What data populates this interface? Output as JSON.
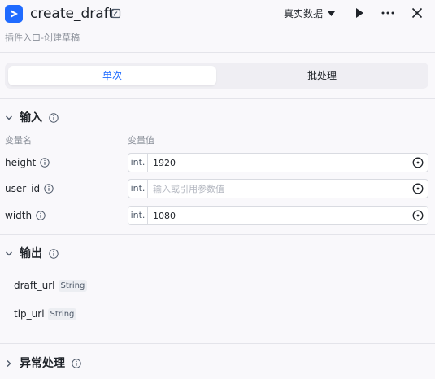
{
  "header": {
    "title": "create_draft",
    "subtitle": "插件入口-创建草稿",
    "mode_label": "真实数据"
  },
  "tabs": [
    {
      "label": "单次",
      "active": true
    },
    {
      "label": "批处理",
      "active": false
    }
  ],
  "input_section": {
    "title": "输入",
    "col_name": "变量名",
    "col_value": "变量值",
    "params": [
      {
        "name": "height",
        "type": "int.",
        "value": "1920",
        "placeholder": ""
      },
      {
        "name": "user_id",
        "type": "int.",
        "value": "",
        "placeholder": "输入或引用参数值"
      },
      {
        "name": "width",
        "type": "int.",
        "value": "1080",
        "placeholder": ""
      }
    ]
  },
  "output_section": {
    "title": "输出",
    "items": [
      {
        "name": "draft_url",
        "type": "String"
      },
      {
        "name": "tip_url",
        "type": "String"
      }
    ]
  },
  "exception_section": {
    "title": "异常处理"
  },
  "colors": {
    "accent": "#1f6bff",
    "background": "#f9f8fb"
  }
}
